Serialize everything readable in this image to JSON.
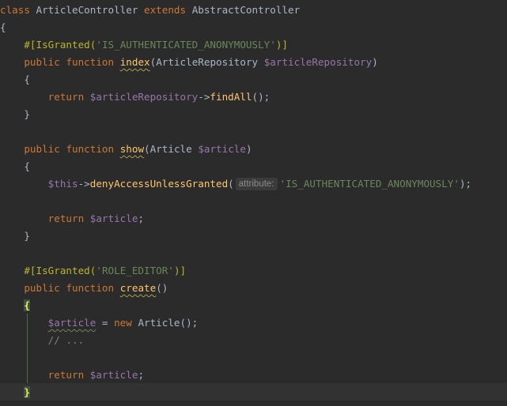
{
  "code": {
    "class_kw": "class",
    "class_name": "ArticleController",
    "extends_kw": "extends",
    "parent_class": "AbstractController",
    "open_class_brace": "{",
    "attr1_open": "#[",
    "attr1_name": "IsGranted",
    "attr1_paren_open": "(",
    "attr1_value": "'IS_AUTHENTICATED_ANONYMOUSLY'",
    "attr1_close": ")]",
    "public_kw": "public",
    "function_kw": "function",
    "m1_name": "index",
    "m1_param_open": "(",
    "m1_param_type": "ArticleRepository",
    "m1_param_var": "$articleRepository",
    "m1_param_close": ")",
    "open_brace": "{",
    "close_brace": "}",
    "return_kw": "return",
    "m1_return_var": "$articleRepository",
    "arrow": "->",
    "m1_call": "findAll",
    "m1_call_tail": "();",
    "m2_name": "show",
    "m2_param_open": "(",
    "m2_param_type": "Article",
    "m2_param_var": "$article",
    "m2_param_close": ")",
    "this_var": "$this",
    "m2_call": "denyAccessUnlessGranted",
    "m2_call_open": "(",
    "m2_hint": "attribute:",
    "m2_arg": "'IS_AUTHENTICATED_ANONYMOUSLY'",
    "m2_call_close": ");",
    "article_var": "$article",
    "semicolon": ";",
    "attr2_open": "#[",
    "attr2_name": "IsGranted",
    "attr2_paren_open": "(",
    "attr2_value": "'ROLE_EDITOR'",
    "attr2_close": ")]",
    "m3_name": "create",
    "m3_parens": "()",
    "assign": " = ",
    "new_kw": "new",
    "new_class": "Article",
    "new_tail": "();",
    "comment": "// ..."
  }
}
